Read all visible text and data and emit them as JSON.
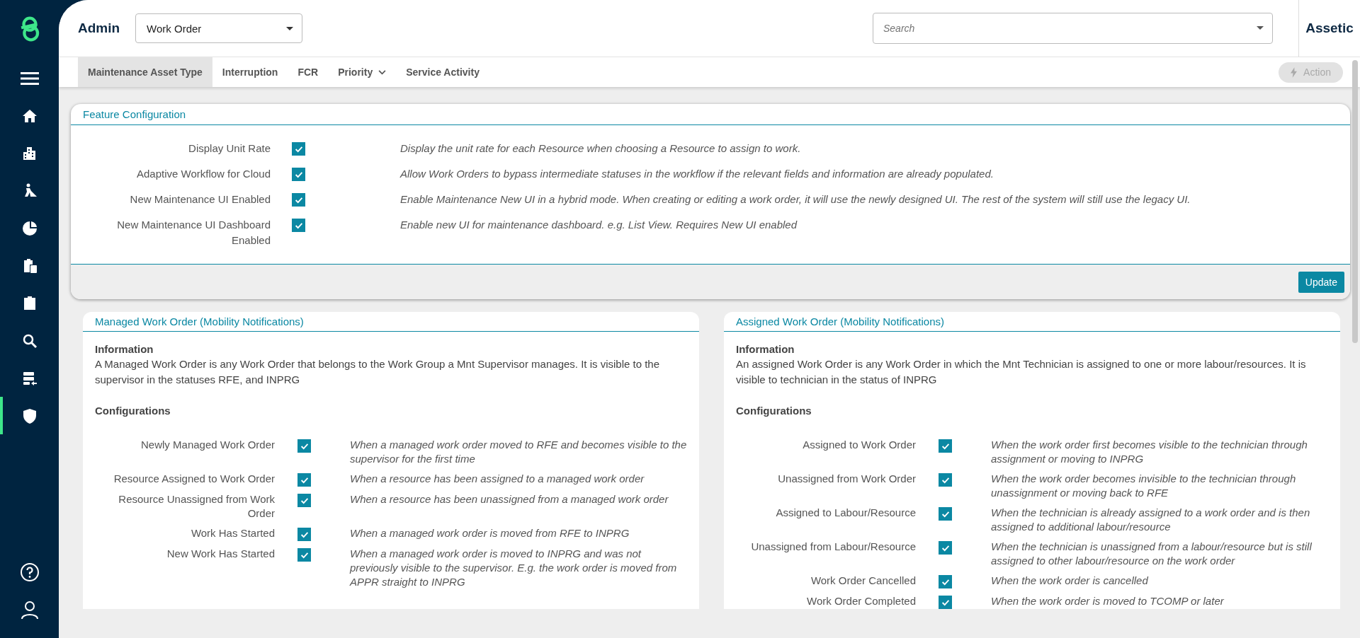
{
  "sidebar": {
    "nav_items": [
      {
        "selected": false
      },
      {
        "selected": false
      },
      {
        "selected": false
      },
      {
        "selected": false
      },
      {
        "selected": false
      },
      {
        "selected": false
      },
      {
        "selected": false
      },
      {
        "selected": false
      },
      {
        "selected": true
      }
    ]
  },
  "header": {
    "title": "Admin",
    "module_select": {
      "value": "Work Order"
    },
    "search": {
      "placeholder": "Search"
    },
    "brand": "Assetic"
  },
  "tabs": [
    {
      "label": "Maintenance Asset Type",
      "selected": true,
      "dropdown": false
    },
    {
      "label": "Interruption",
      "selected": false,
      "dropdown": false
    },
    {
      "label": "FCR",
      "selected": false,
      "dropdown": false
    },
    {
      "label": "Priority",
      "selected": false,
      "dropdown": true
    },
    {
      "label": "Service Activity",
      "selected": false,
      "dropdown": false
    }
  ],
  "action_button": {
    "label": "Action",
    "disabled": true
  },
  "feature_configuration": {
    "title": "Feature Configuration",
    "rows": [
      {
        "label": "Display Unit Rate",
        "checked": true,
        "description": "Display the unit rate for each Resource when choosing a Resource to assign to work."
      },
      {
        "label": "Adaptive Workflow for Cloud",
        "checked": true,
        "description": "Allow Work Orders to bypass intermediate statuses in the workflow if the relevant fields and information are already populated."
      },
      {
        "label": "New Maintenance UI Enabled",
        "checked": true,
        "description": "Enable Maintenance New UI in a hybrid mode. When creating or editing a work order, it will use the newly designed UI. The rest of the system will still use the legacy UI."
      },
      {
        "label": "New Maintenance UI Dashboard Enabled",
        "checked": true,
        "description": "Enable new UI for maintenance dashboard. e.g. List View. Requires New UI enabled"
      }
    ],
    "update_button": "Update"
  },
  "cards": [
    {
      "title": "Managed Work Order (Mobility Notifications)",
      "info_heading": "Information",
      "info_text": "A Managed Work Order is any Work Order that belongs to the Work Group a Mnt Supervisor manages. It is visible to the supervisor in the statuses RFE, and INPRG",
      "config_heading": "Configurations",
      "rows": [
        {
          "label": "Newly Managed Work Order",
          "checked": true,
          "description": "When a managed work order moved to RFE and becomes visible to the supervisor for the first time"
        },
        {
          "label": "Resource Assigned to Work Order",
          "checked": true,
          "description": "When a resource has been assigned to a managed work order"
        },
        {
          "label": "Resource Unassigned from Work Order",
          "checked": true,
          "description": "When a resource has been unassigned from a managed work order"
        },
        {
          "label": "Work Has Started",
          "checked": true,
          "description": "When a managed work order is moved from RFE to INPRG"
        },
        {
          "label": "New Work Has Started",
          "checked": true,
          "description": "When a managed work order is moved to INPRG and was not previously visible to the supervisor. E.g. the work order is moved from APPR straight to INPRG"
        }
      ]
    },
    {
      "title": "Assigned Work Order (Mobility Notifications)",
      "info_heading": "Information",
      "info_text": "An assigned Work Order is any Work Order in which the Mnt Technician is assigned to one or more labour/resources. It is visible to technician in the status of INPRG",
      "config_heading": "Configurations",
      "rows": [
        {
          "label": "Assigned to Work Order",
          "checked": true,
          "description": "When the work order first becomes visible to the technician through assignment or moving to INPRG"
        },
        {
          "label": "Unassigned from Work Order",
          "checked": true,
          "description": "When the work order becomes invisible to the technician through unassignment or moving back to RFE"
        },
        {
          "label": "Assigned to Labour/Resource",
          "checked": true,
          "description": "When the technician is already assigned to a work order and is then assigned to additional labour/resource"
        },
        {
          "label": "Unassigned from Labour/Resource",
          "checked": true,
          "description": "When the technician is unassigned from a labour/resource but is still assigned to other labour/resource on the work order"
        },
        {
          "label": "Work Order Cancelled",
          "checked": true,
          "description": "When the work order is cancelled"
        },
        {
          "label": "Work Order Completed",
          "checked": true,
          "description": "When the work order is moved to TCOMP or later"
        }
      ]
    }
  ]
}
